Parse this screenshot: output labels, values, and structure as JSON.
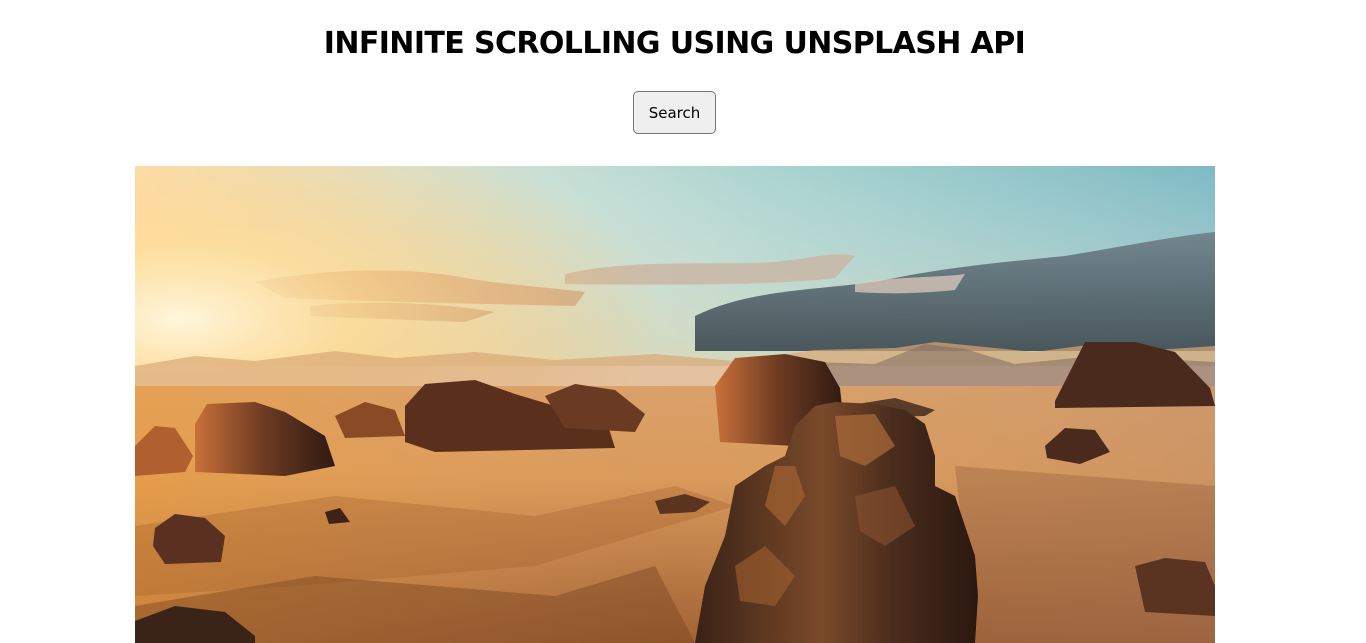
{
  "header": {
    "title": "INFINITE SCROLLING USING UNSPLASH API"
  },
  "search": {
    "button_label": "Search"
  },
  "gallery": {
    "images": [
      {
        "subject": "desert-rock-formations-at-sunset"
      }
    ]
  },
  "colors": {
    "background": "#ffffff",
    "button_bg": "#efefef",
    "button_border": "#767676",
    "text": "#000000"
  }
}
